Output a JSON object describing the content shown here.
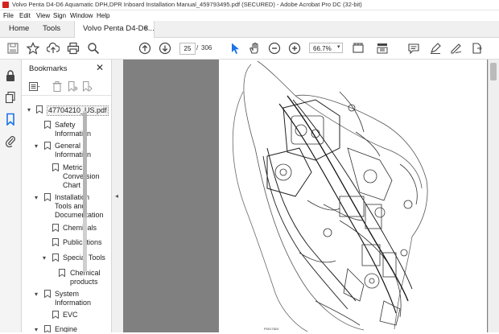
{
  "window": {
    "title": "Volvo Penta D4-D6 Aquamatic DPH,DPR Inboard Installation Manual_459793495.pdf (SECURED) - Adobe Acrobat Pro DC (32-bit)"
  },
  "menu": [
    "File",
    "Edit",
    "View",
    "Sign",
    "Window",
    "Help"
  ],
  "tabs": {
    "home": "Home",
    "tools": "Tools",
    "document": "Volvo Penta D4-D6...",
    "close": "×"
  },
  "toolbar": {
    "page_current": "25",
    "page_separator": "/",
    "page_total": "306",
    "zoom": "66.7%",
    "icons": [
      "save-icon",
      "bookmark-star-icon",
      "upload-icon",
      "print-icon",
      "search-icon",
      "page-up-icon",
      "page-down-icon",
      "select-arrow-icon",
      "hand-icon",
      "zoom-out-icon",
      "zoom-in-icon",
      "zoom-dropdown",
      "marquee-icon",
      "scroll-mode-icon",
      "comment-icon",
      "highlight-icon",
      "sign-pen-icon",
      "share-icon"
    ]
  },
  "bookmarks": {
    "title": "Bookmarks",
    "close": "✕",
    "items": [
      {
        "label": "47704210_US.pdf",
        "level": 0,
        "arrow": "▾"
      },
      {
        "label": "Safety",
        "label2": "Information",
        "level": 1,
        "arrow": ""
      },
      {
        "label": "General",
        "label2": "Information",
        "level": 1,
        "arrow": "▾"
      },
      {
        "label": "Metric",
        "label2": "Conversion",
        "label3": "Chart",
        "level": 2,
        "arrow": ""
      },
      {
        "label": "Installation",
        "label2": "Tools and",
        "label3": "Documentation",
        "level": 1,
        "arrow": "▾"
      },
      {
        "label": "Chemicals",
        "level": 2,
        "arrow": ""
      },
      {
        "label": "Publications",
        "level": 2,
        "arrow": ""
      },
      {
        "label": "Special Tools",
        "level": 2,
        "arrow": "▾"
      },
      {
        "label": "Chemical",
        "label2": "products",
        "level": 3,
        "arrow": ""
      },
      {
        "label": "System",
        "label2": "Information",
        "level": 1,
        "arrow": "▾"
      },
      {
        "label": "EVC",
        "level": 2,
        "arrow": ""
      },
      {
        "label": "Engine",
        "level": 1,
        "arrow": "▾"
      }
    ]
  },
  "pdf": {
    "figure_caption": "P0017824"
  }
}
